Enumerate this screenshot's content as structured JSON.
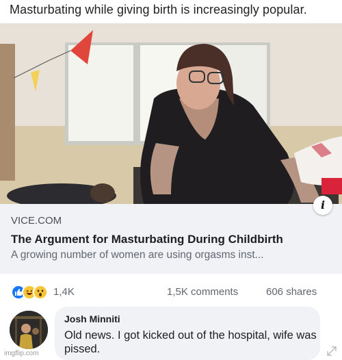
{
  "caption": "Masturbating while giving birth is increasingly popular.",
  "link": {
    "source": "VICE.COM",
    "headline": "The Argument for Masturbating During Childbirth",
    "description": "A growing number of women are using orgasms inst...",
    "info_icon": "i"
  },
  "stats": {
    "reaction_count": "1,4K",
    "comments": "1,5K comments",
    "shares": "606 shares",
    "reaction_icons": [
      "like-icon",
      "haha-icon",
      "wow-icon"
    ]
  },
  "comment": {
    "author": "Josh Minniti",
    "text": "Old news. I got kicked out of the hospital, wife was pissed."
  },
  "watermark": "imgflip.com",
  "colors": {
    "accent": "#1877f2",
    "card_bg": "#f0f2f5",
    "emoji": "#f7c637"
  }
}
